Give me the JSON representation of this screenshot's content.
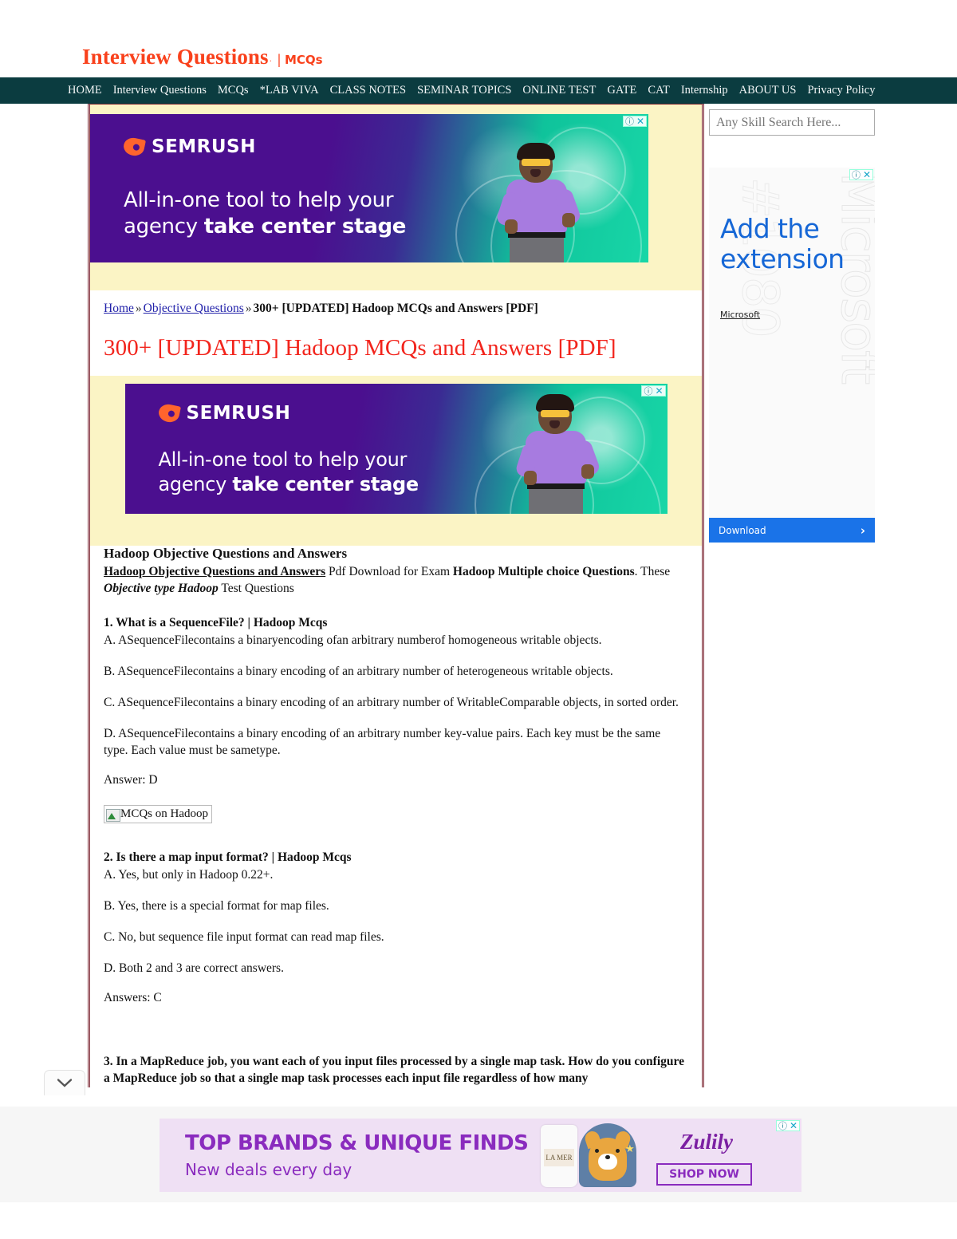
{
  "header": {
    "logo_main": "Interview Questions",
    "logo_tm": "·",
    "logo_separator": "|",
    "logo_sub": "MCQs"
  },
  "nav": {
    "items": [
      {
        "label": "HOME"
      },
      {
        "label": "Interview Questions"
      },
      {
        "label": "MCQs"
      },
      {
        "label": "*LAB VIVA"
      },
      {
        "label": "CLASS NOTES"
      },
      {
        "label": "SEMINAR TOPICS"
      },
      {
        "label": "ONLINE TEST"
      },
      {
        "label": "GATE"
      },
      {
        "label": "CAT"
      },
      {
        "label": "Internship"
      },
      {
        "label": "ABOUT US"
      },
      {
        "label": "Privacy Policy"
      }
    ]
  },
  "search": {
    "placeholder": "Any Skill Search Here..."
  },
  "breadcrumb": {
    "home": "Home",
    "sep1": "»",
    "parent": "Objective Questions",
    "sep2": "»",
    "current": "300+ [UPDATED] Hadoop MCQs and Answers [PDF]"
  },
  "article": {
    "title": "300+ [UPDATED] Hadoop MCQs and Answers [PDF]",
    "section_heading": "Hadoop Objective Questions and Answers",
    "intro_link": "Hadoop Objective Questions and Answers",
    "intro_mid": " Pdf Download for Exam ",
    "intro_bold": "Hadoop Multiple choice Questions",
    "intro_after": ". These ",
    "intro_italic": "Objective type Hadoop",
    "intro_tail": " Test Questions",
    "questions": [
      {
        "heading": "1. What is a SequenceFile? | Hadoop Mcqs",
        "options": [
          "A. ASequenceFilecontains a binaryencoding ofan arbitrary numberof homogeneous writable objects.",
          "B. ASequenceFilecontains a binary encoding of an arbitrary number of heterogeneous writable objects.",
          "C. ASequenceFilecontains a binary encoding of an arbitrary number of WritableComparable objects, in sorted order.",
          "D. ASequenceFilecontains a binary encoding of an arbitrary number key-value pairs. Each key must be the same type. Each value must be sametype."
        ],
        "answer": "Answer: D",
        "image_alt": "MCQs on Hadoop"
      },
      {
        "heading": "2. Is there a map input format? | Hadoop Mcqs",
        "options": [
          "A. Yes, but only in Hadoop 0.22+.",
          "B. Yes, there is a special format for map files.",
          "C. No, but sequence file input format can read map files.",
          "D. Both 2 and 3 are correct answers."
        ],
        "answer": "Answers: C"
      },
      {
        "heading": "3. In a MapReduce job, you want each of you input files processed by a single map task. How do you configure a MapReduce job so that a single map task processes each input file regardless of how many"
      }
    ]
  },
  "ads": {
    "semrush_top": {
      "brand": "SEMRUSH",
      "headline_line1": "All-in-one tool to help your",
      "headline_line2_plain": "agency ",
      "headline_line2_bold": "take center stage",
      "adchoices_info": "ⓘ",
      "adchoices_close": "✕"
    },
    "semrush_mid": {
      "brand": "SEMRUSH",
      "headline_line1": "All-in-one tool to help your",
      "headline_line2_plain": "agency ",
      "headline_line2_bold": "take center stage",
      "adchoices_info": "ⓘ",
      "adchoices_close": "✕"
    },
    "sidebar": {
      "watermark_right": "Microsoft",
      "watermark_left": "#1080",
      "headline": "Add the extension",
      "brand": "Microsoft",
      "cta_label": "Download",
      "cta_chevron": "›",
      "adchoices_info": "ⓘ",
      "adchoices_close": "✕"
    },
    "bottom": {
      "headline": "TOP BRANDS & UNIQUE FINDS",
      "subline": "New deals every day",
      "brand": "Zulily",
      "cta_label": "SHOP NOW",
      "product_label": "LA MER",
      "adchoices_info": "ⓘ",
      "adchoices_close": "✕"
    }
  },
  "colors": {
    "logo": "#F9411C",
    "nav_bg": "#0B3C40",
    "title": "#F2241C",
    "frame_border": "#7B2430",
    "ad_yellow": "#FBF4C5",
    "link_blue": "#2222AA",
    "download_blue": "#1A73E8",
    "zulily_purple": "#8A2BBE"
  }
}
